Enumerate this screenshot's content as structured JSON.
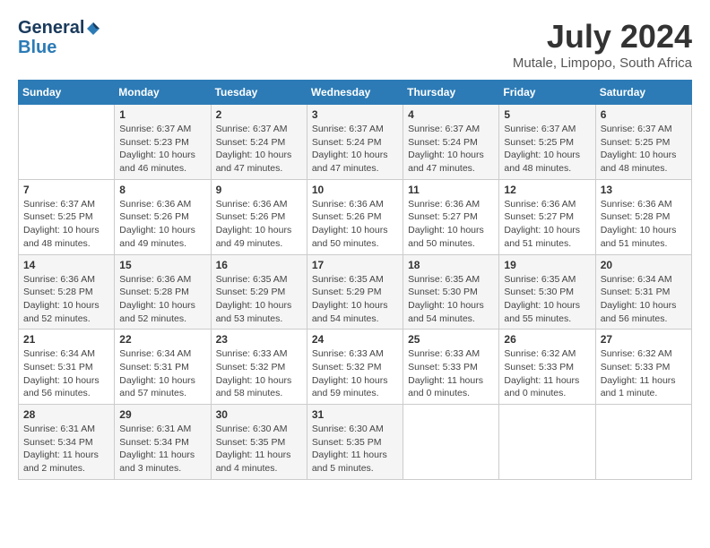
{
  "header": {
    "logo_text_general": "General",
    "logo_text_blue": "Blue",
    "month_year": "July 2024",
    "location": "Mutale, Limpopo, South Africa"
  },
  "weekdays": [
    "Sunday",
    "Monday",
    "Tuesday",
    "Wednesday",
    "Thursday",
    "Friday",
    "Saturday"
  ],
  "weeks": [
    [
      {
        "day": "",
        "sunrise": "",
        "sunset": "",
        "daylight": ""
      },
      {
        "day": "1",
        "sunrise": "Sunrise: 6:37 AM",
        "sunset": "Sunset: 5:23 PM",
        "daylight": "Daylight: 10 hours and 46 minutes."
      },
      {
        "day": "2",
        "sunrise": "Sunrise: 6:37 AM",
        "sunset": "Sunset: 5:24 PM",
        "daylight": "Daylight: 10 hours and 47 minutes."
      },
      {
        "day": "3",
        "sunrise": "Sunrise: 6:37 AM",
        "sunset": "Sunset: 5:24 PM",
        "daylight": "Daylight: 10 hours and 47 minutes."
      },
      {
        "day": "4",
        "sunrise": "Sunrise: 6:37 AM",
        "sunset": "Sunset: 5:24 PM",
        "daylight": "Daylight: 10 hours and 47 minutes."
      },
      {
        "day": "5",
        "sunrise": "Sunrise: 6:37 AM",
        "sunset": "Sunset: 5:25 PM",
        "daylight": "Daylight: 10 hours and 48 minutes."
      },
      {
        "day": "6",
        "sunrise": "Sunrise: 6:37 AM",
        "sunset": "Sunset: 5:25 PM",
        "daylight": "Daylight: 10 hours and 48 minutes."
      }
    ],
    [
      {
        "day": "7",
        "sunrise": "Sunrise: 6:37 AM",
        "sunset": "Sunset: 5:25 PM",
        "daylight": "Daylight: 10 hours and 48 minutes."
      },
      {
        "day": "8",
        "sunrise": "Sunrise: 6:36 AM",
        "sunset": "Sunset: 5:26 PM",
        "daylight": "Daylight: 10 hours and 49 minutes."
      },
      {
        "day": "9",
        "sunrise": "Sunrise: 6:36 AM",
        "sunset": "Sunset: 5:26 PM",
        "daylight": "Daylight: 10 hours and 49 minutes."
      },
      {
        "day": "10",
        "sunrise": "Sunrise: 6:36 AM",
        "sunset": "Sunset: 5:26 PM",
        "daylight": "Daylight: 10 hours and 50 minutes."
      },
      {
        "day": "11",
        "sunrise": "Sunrise: 6:36 AM",
        "sunset": "Sunset: 5:27 PM",
        "daylight": "Daylight: 10 hours and 50 minutes."
      },
      {
        "day": "12",
        "sunrise": "Sunrise: 6:36 AM",
        "sunset": "Sunset: 5:27 PM",
        "daylight": "Daylight: 10 hours and 51 minutes."
      },
      {
        "day": "13",
        "sunrise": "Sunrise: 6:36 AM",
        "sunset": "Sunset: 5:28 PM",
        "daylight": "Daylight: 10 hours and 51 minutes."
      }
    ],
    [
      {
        "day": "14",
        "sunrise": "Sunrise: 6:36 AM",
        "sunset": "Sunset: 5:28 PM",
        "daylight": "Daylight: 10 hours and 52 minutes."
      },
      {
        "day": "15",
        "sunrise": "Sunrise: 6:36 AM",
        "sunset": "Sunset: 5:28 PM",
        "daylight": "Daylight: 10 hours and 52 minutes."
      },
      {
        "day": "16",
        "sunrise": "Sunrise: 6:35 AM",
        "sunset": "Sunset: 5:29 PM",
        "daylight": "Daylight: 10 hours and 53 minutes."
      },
      {
        "day": "17",
        "sunrise": "Sunrise: 6:35 AM",
        "sunset": "Sunset: 5:29 PM",
        "daylight": "Daylight: 10 hours and 54 minutes."
      },
      {
        "day": "18",
        "sunrise": "Sunrise: 6:35 AM",
        "sunset": "Sunset: 5:30 PM",
        "daylight": "Daylight: 10 hours and 54 minutes."
      },
      {
        "day": "19",
        "sunrise": "Sunrise: 6:35 AM",
        "sunset": "Sunset: 5:30 PM",
        "daylight": "Daylight: 10 hours and 55 minutes."
      },
      {
        "day": "20",
        "sunrise": "Sunrise: 6:34 AM",
        "sunset": "Sunset: 5:31 PM",
        "daylight": "Daylight: 10 hours and 56 minutes."
      }
    ],
    [
      {
        "day": "21",
        "sunrise": "Sunrise: 6:34 AM",
        "sunset": "Sunset: 5:31 PM",
        "daylight": "Daylight: 10 hours and 56 minutes."
      },
      {
        "day": "22",
        "sunrise": "Sunrise: 6:34 AM",
        "sunset": "Sunset: 5:31 PM",
        "daylight": "Daylight: 10 hours and 57 minutes."
      },
      {
        "day": "23",
        "sunrise": "Sunrise: 6:33 AM",
        "sunset": "Sunset: 5:32 PM",
        "daylight": "Daylight: 10 hours and 58 minutes."
      },
      {
        "day": "24",
        "sunrise": "Sunrise: 6:33 AM",
        "sunset": "Sunset: 5:32 PM",
        "daylight": "Daylight: 10 hours and 59 minutes."
      },
      {
        "day": "25",
        "sunrise": "Sunrise: 6:33 AM",
        "sunset": "Sunset: 5:33 PM",
        "daylight": "Daylight: 11 hours and 0 minutes."
      },
      {
        "day": "26",
        "sunrise": "Sunrise: 6:32 AM",
        "sunset": "Sunset: 5:33 PM",
        "daylight": "Daylight: 11 hours and 0 minutes."
      },
      {
        "day": "27",
        "sunrise": "Sunrise: 6:32 AM",
        "sunset": "Sunset: 5:33 PM",
        "daylight": "Daylight: 11 hours and 1 minute."
      }
    ],
    [
      {
        "day": "28",
        "sunrise": "Sunrise: 6:31 AM",
        "sunset": "Sunset: 5:34 PM",
        "daylight": "Daylight: 11 hours and 2 minutes."
      },
      {
        "day": "29",
        "sunrise": "Sunrise: 6:31 AM",
        "sunset": "Sunset: 5:34 PM",
        "daylight": "Daylight: 11 hours and 3 minutes."
      },
      {
        "day": "30",
        "sunrise": "Sunrise: 6:30 AM",
        "sunset": "Sunset: 5:35 PM",
        "daylight": "Daylight: 11 hours and 4 minutes."
      },
      {
        "day": "31",
        "sunrise": "Sunrise: 6:30 AM",
        "sunset": "Sunset: 5:35 PM",
        "daylight": "Daylight: 11 hours and 5 minutes."
      },
      {
        "day": "",
        "sunrise": "",
        "sunset": "",
        "daylight": ""
      },
      {
        "day": "",
        "sunrise": "",
        "sunset": "",
        "daylight": ""
      },
      {
        "day": "",
        "sunrise": "",
        "sunset": "",
        "daylight": ""
      }
    ]
  ]
}
